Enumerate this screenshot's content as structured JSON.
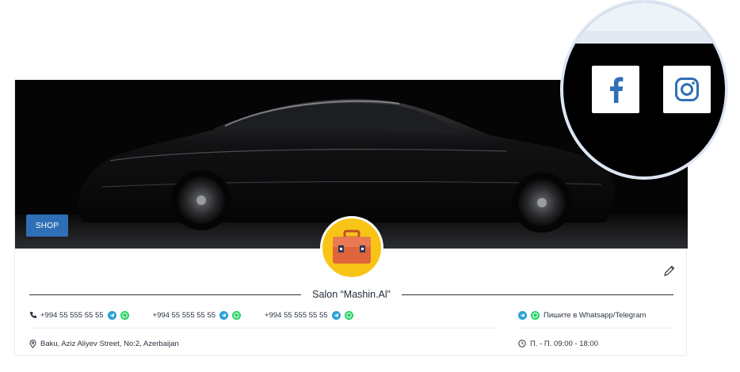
{
  "cover": {
    "badge_label": "SHOP"
  },
  "store": {
    "name": "Salon “Mashin.Al”",
    "avatar_icon": "briefcase-icon"
  },
  "contacts": {
    "phones": [
      "+994 55 555 55 55",
      "+994 55 555 55 55",
      "+994 55 555 55 55"
    ],
    "messenger_hint": "Пишите в Whatsapp/Telegram",
    "address": "Baku, Aziz Aliyev Street, No:2, Azerbaijan",
    "hours": "П. - П. 09:00 - 18:00"
  },
  "social": {
    "facebook_icon": "facebook-icon",
    "instagram_icon": "instagram-icon"
  },
  "colors": {
    "accent": "#2f6fb6",
    "telegram": "#2a9fd8",
    "whatsapp": "#25d366",
    "avatar_bg": "#f8c416",
    "briefcase": "#e0643b"
  }
}
